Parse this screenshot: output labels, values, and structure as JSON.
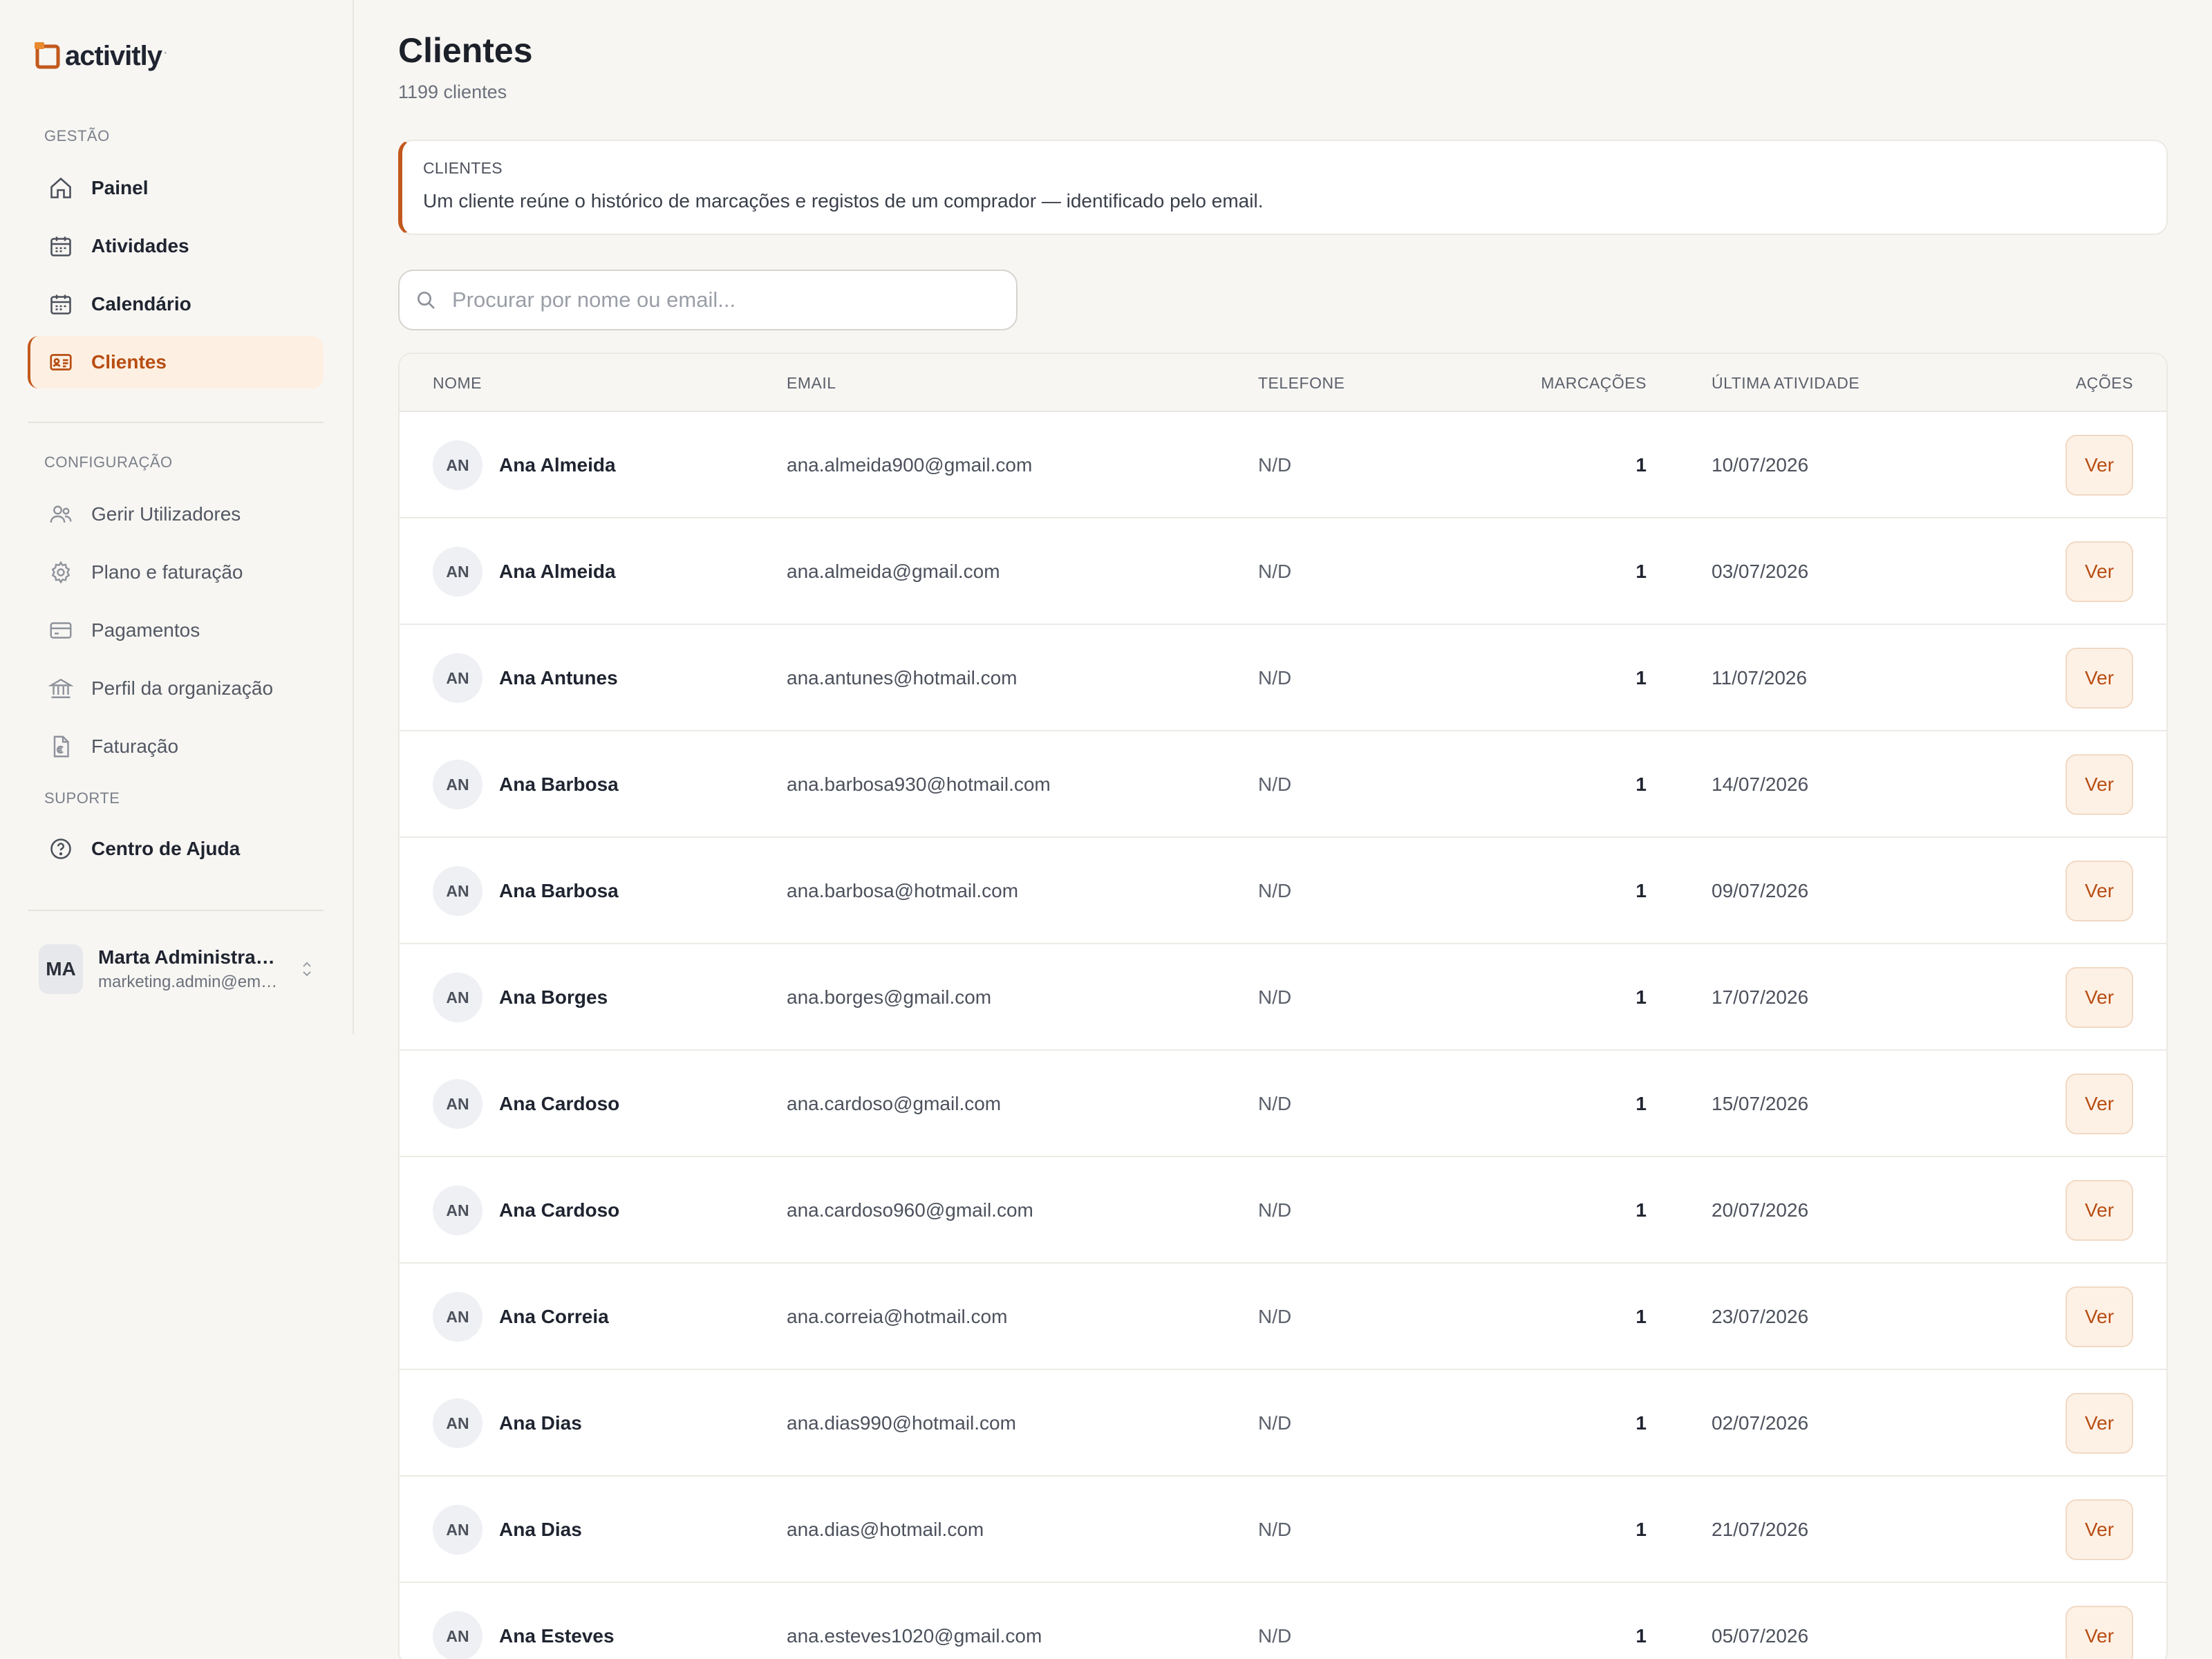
{
  "brand": {
    "name": "activitly",
    "mark": "·",
    "accent": "#c2591c"
  },
  "sidebar": {
    "sections": {
      "gestao": "GESTÃO",
      "configuracao": "CONFIGURAÇÃO",
      "suporte": "SUPORTE"
    },
    "items": [
      {
        "label": "Painel",
        "icon": "home-icon"
      },
      {
        "label": "Atividades",
        "icon": "calendar-icon"
      },
      {
        "label": "Calendário",
        "icon": "calendar-icon"
      },
      {
        "label": "Clientes",
        "icon": "id-card-icon",
        "active": true
      },
      {
        "label": "Gerir Utilizadores",
        "icon": "users-icon"
      },
      {
        "label": "Plano e faturação",
        "icon": "gear-icon"
      },
      {
        "label": "Pagamentos",
        "icon": "credit-card-icon"
      },
      {
        "label": "Perfil da organização",
        "icon": "bank-icon"
      },
      {
        "label": "Faturação",
        "icon": "euro-document-icon"
      },
      {
        "label": "Centro de Ajuda",
        "icon": "help-circle-icon"
      }
    ],
    "user": {
      "initials": "MA",
      "name": "Marta Administradora",
      "email": "marketing.admin@empresa.pt"
    }
  },
  "header": {
    "title": "Clientes",
    "subtitle": "1199 clientes"
  },
  "info": {
    "title": "CLIENTES",
    "text": "Um cliente reúne o histórico de marcações e registos de um comprador — identificado pelo email."
  },
  "search": {
    "placeholder": "Procurar por nome ou email...",
    "value": ""
  },
  "table": {
    "headers": {
      "name": "NOME",
      "email": "EMAIL",
      "phone": "TELEFONE",
      "bookings": "MARCAÇÕES",
      "last_activity": "ÚLTIMA ATIVIDADE",
      "actions": "AÇÕES"
    },
    "action_label": "Ver",
    "rows": [
      {
        "initials": "AN",
        "name": "Ana Almeida",
        "email": "ana.almeida900@gmail.com",
        "phone": "N/D",
        "bookings": "1",
        "last_activity": "10/07/2026"
      },
      {
        "initials": "AN",
        "name": "Ana Almeida",
        "email": "ana.almeida@gmail.com",
        "phone": "N/D",
        "bookings": "1",
        "last_activity": "03/07/2026"
      },
      {
        "initials": "AN",
        "name": "Ana Antunes",
        "email": "ana.antunes@hotmail.com",
        "phone": "N/D",
        "bookings": "1",
        "last_activity": "11/07/2026"
      },
      {
        "initials": "AN",
        "name": "Ana Barbosa",
        "email": "ana.barbosa930@hotmail.com",
        "phone": "N/D",
        "bookings": "1",
        "last_activity": "14/07/2026"
      },
      {
        "initials": "AN",
        "name": "Ana Barbosa",
        "email": "ana.barbosa@hotmail.com",
        "phone": "N/D",
        "bookings": "1",
        "last_activity": "09/07/2026"
      },
      {
        "initials": "AN",
        "name": "Ana Borges",
        "email": "ana.borges@gmail.com",
        "phone": "N/D",
        "bookings": "1",
        "last_activity": "17/07/2026"
      },
      {
        "initials": "AN",
        "name": "Ana Cardoso",
        "email": "ana.cardoso@gmail.com",
        "phone": "N/D",
        "bookings": "1",
        "last_activity": "15/07/2026"
      },
      {
        "initials": "AN",
        "name": "Ana Cardoso",
        "email": "ana.cardoso960@gmail.com",
        "phone": "N/D",
        "bookings": "1",
        "last_activity": "20/07/2026"
      },
      {
        "initials": "AN",
        "name": "Ana Correia",
        "email": "ana.correia@hotmail.com",
        "phone": "N/D",
        "bookings": "1",
        "last_activity": "23/07/2026"
      },
      {
        "initials": "AN",
        "name": "Ana Dias",
        "email": "ana.dias990@hotmail.com",
        "phone": "N/D",
        "bookings": "1",
        "last_activity": "02/07/2026"
      },
      {
        "initials": "AN",
        "name": "Ana Dias",
        "email": "ana.dias@hotmail.com",
        "phone": "N/D",
        "bookings": "1",
        "last_activity": "21/07/2026"
      },
      {
        "initials": "AN",
        "name": "Ana Esteves",
        "email": "ana.esteves1020@gmail.com",
        "phone": "N/D",
        "bookings": "1",
        "last_activity": "05/07/2026"
      }
    ]
  }
}
